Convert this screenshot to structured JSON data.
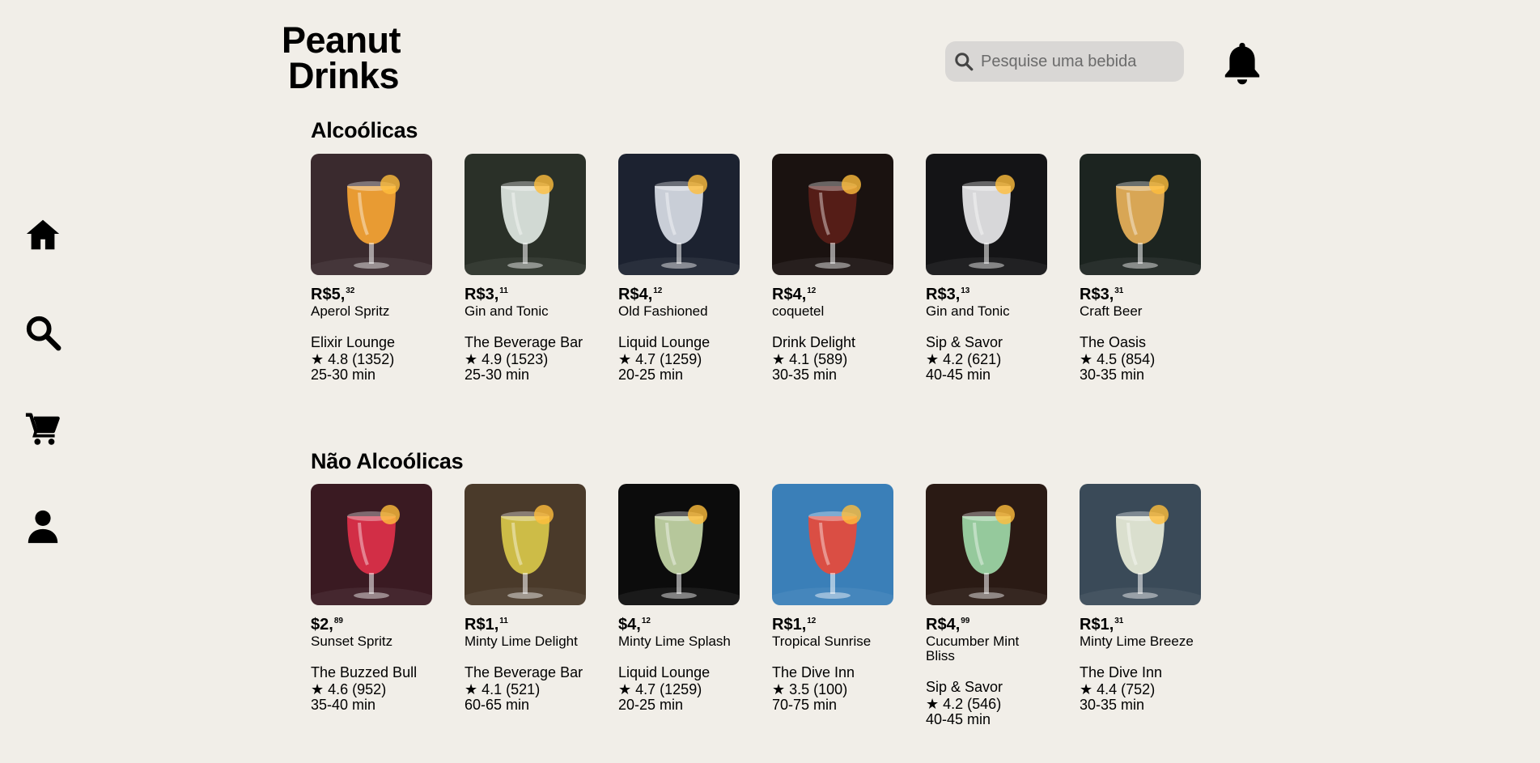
{
  "app": {
    "logo_line1": "Peanut",
    "logo_line2": "Drinks"
  },
  "search": {
    "placeholder": "Pesquise uma bebida"
  },
  "sections": [
    {
      "title": "Alcoólicas",
      "items": [
        {
          "price_main": "R$5,",
          "price_cents": "32",
          "name": "Aperol Spritz",
          "place": "Elixir Lounge",
          "rating": "★ 4.8 (1352)",
          "time": "25-30 min",
          "bg": "#3a2a2e",
          "glass": "#f7a534"
        },
        {
          "price_main": "R$3,",
          "price_cents": "11",
          "name": "Gin and Tonic",
          "place": "The Beverage Bar",
          "rating": "★ 4.9 (1523)",
          "time": "25-30 min",
          "bg": "#2a3028",
          "glass": "#dfe8e2"
        },
        {
          "price_main": "R$4,",
          "price_cents": "12",
          "name": "Old Fashioned",
          "place": "Liquid Lounge",
          "rating": "★ 4.7 (1259)",
          "time": "20-25 min",
          "bg": "#1c2230",
          "glass": "#d8dde6"
        },
        {
          "price_main": "R$4,",
          "price_cents": "12",
          "name": "coquetel",
          "place": "Drink Delight",
          "rating": "★ 4.1 (589)",
          "time": "30-35 min",
          "bg": "#1a1210",
          "glass": "#5a1e18"
        },
        {
          "price_main": "R$3,",
          "price_cents": "13",
          "name": "Gin and Tonic",
          "place": "Sip & Savor",
          "rating": "★ 4.2 (621)",
          "time": "40-45 min",
          "bg": "#141416",
          "glass": "#e8e8ea"
        },
        {
          "price_main": "R$3,",
          "price_cents": "31",
          "name": "Craft Beer",
          "place": "The Oasis",
          "rating": "★ 4.5 (854)",
          "time": "30-35 min",
          "bg": "#1c2420",
          "glass": "#e8b25a"
        }
      ]
    },
    {
      "title": "Não Alcoólicas",
      "items": [
        {
          "price_main": "$2,",
          "price_cents": "89",
          "name": "Sunset Spritz",
          "place": "The Buzzed Bull",
          "rating": "★ 4.6 (952)",
          "time": "35-40 min",
          "bg": "#3a1a22",
          "glass": "#e0304a"
        },
        {
          "price_main": "R$1,",
          "price_cents": "11",
          "name": "Minty Lime Delight",
          "place": "The Beverage Bar",
          "rating": "★ 4.1 (521)",
          "time": "60-65 min",
          "bg": "#4a3a2a",
          "glass": "#d8c84a"
        },
        {
          "price_main": "$4,",
          "price_cents": "12",
          "name": "Minty Lime Splash",
          "place": "Liquid Lounge",
          "rating": "★ 4.7 (1259)",
          "time": "20-25 min",
          "bg": "#0c0c0c",
          "glass": "#c6d8a8"
        },
        {
          "price_main": "R$1,",
          "price_cents": "12",
          "name": "Tropical Sunrise",
          "place": "The Dive Inn",
          "rating": "★ 3.5 (100)",
          "time": "70-75 min",
          "bg": "#3a7fb8",
          "glass": "#e84a3a"
        },
        {
          "price_main": "R$4,",
          "price_cents": "99",
          "name": "Cucumber Mint Bliss",
          "place": "Sip & Savor",
          "rating": "★ 4.2 (546)",
          "time": "40-45 min",
          "bg": "#2a1a14",
          "glass": "#9ed8a8"
        },
        {
          "price_main": "R$1,",
          "price_cents": "31",
          "name": "Minty Lime Breeze",
          "place": "The Dive Inn",
          "rating": "★ 4.4 (752)",
          "time": "30-35 min",
          "bg": "#3a4a58",
          "glass": "#e8ecd8"
        }
      ]
    }
  ]
}
